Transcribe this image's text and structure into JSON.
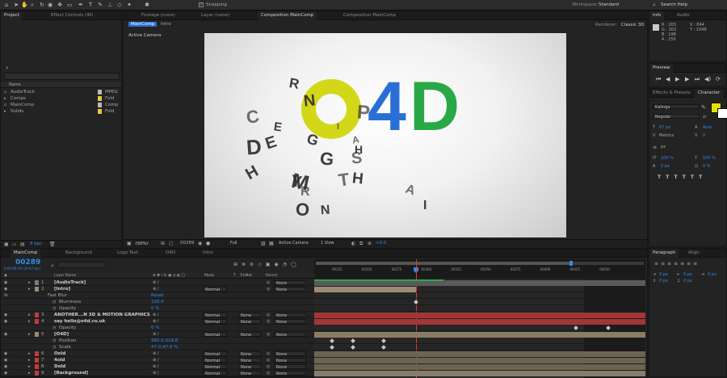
{
  "app": {
    "workspace_label": "Workspace:",
    "workspace_value": "Standard",
    "search_help": "Search Help",
    "snapping": "Snapping"
  },
  "project": {
    "tab": "Project",
    "tab2": "Effect Controls (4D",
    "col_name": "Name",
    "items": [
      {
        "name": "AudioTrack",
        "type": "MPEG",
        "color": "#b8b8b8"
      },
      {
        "name": "Comps",
        "type": "Fold",
        "color": "#e6c83c"
      },
      {
        "name": "MainComp",
        "type": "Comp",
        "color": "#b8b8b8"
      },
      {
        "name": "Solids",
        "type": "Fold",
        "color": "#e6c83c"
      }
    ],
    "bpc": "8 bpc"
  },
  "viewer": {
    "tabs": [
      "Footage (none)",
      "Layer (none)",
      "Composition MainComp",
      "Composition MainComp"
    ],
    "crumbs": [
      "MainComp",
      "Intro"
    ],
    "renderer_label": "Renderer:",
    "renderer_value": "Classic 3D",
    "active_camera": "Active Camera",
    "logo": {
      "o_color": "#d2d817",
      "four_color": "#2a6fd6",
      "d_color": "#2aa847"
    },
    "bottom": {
      "zoom": "(50%)",
      "frame": "00289",
      "resolution": "Full",
      "camera": "Active Camera",
      "views": "1 View",
      "offset": "+0.0"
    },
    "letters": [
      "C",
      "R",
      "N",
      "P",
      "E",
      "G",
      "I",
      "D",
      "E",
      "A",
      "G",
      "H",
      "S",
      "M",
      "O",
      "T",
      "H",
      "N",
      "R",
      "I",
      "H",
      "A",
      "Y"
    ]
  },
  "info": {
    "tab": "Info",
    "tab2": "Audio",
    "r": "R : 203",
    "g": "G : 202",
    "b": "B : 198",
    "a": "A : 255",
    "x": "X : 844",
    "y": "Y : 1048"
  },
  "preview": {
    "tab": "Preview"
  },
  "character": {
    "tab1": "Effects & Presets",
    "tab2": "Character",
    "font": "Kalinga",
    "style": "Regular",
    "size": "67 px",
    "leading": "Auto",
    "tracking": "0",
    "unit": "px",
    "vscale": "100 %",
    "hscale": "100 %",
    "baseline": "0 px",
    "tsume": "0 %",
    "swatch_fill": "#e4e000"
  },
  "paragraph": {
    "tab1": "Paragraph",
    "tab2": "Align",
    "values": [
      "0 px",
      "0 px",
      "0 px",
      "0 px",
      "0 px"
    ]
  },
  "timeline": {
    "tabs": [
      "MainComp",
      "Background",
      "Logo Text",
      "O4D",
      "Intro"
    ],
    "timecode": "00289",
    "timecode_sub": "0:00:09:19 (29.97 fps)",
    "col_layer": "Layer Name",
    "col_mode": "Mode",
    "col_t": "T",
    "col_trkmat": "TrkMat",
    "col_parent": "Parent",
    "ruler": [
      "00225",
      "00250",
      "00275",
      "00300",
      "00325",
      "00350",
      "00375",
      "00400",
      "00425",
      "00450"
    ],
    "rows": [
      {
        "num": "1",
        "name": "[AudioTrack]",
        "color": "#7b7b7b",
        "mode": "",
        "trk": "",
        "parent": "None",
        "kind": "layer"
      },
      {
        "num": "2",
        "name": "[Intro]",
        "color": "#9a8c74",
        "mode": "Normal",
        "trk": "",
        "parent": "None",
        "kind": "layer"
      },
      {
        "num": "",
        "name": "Fast Blur",
        "value": "Reset",
        "kind": "effect"
      },
      {
        "num": "",
        "name": "Blurriness",
        "value": "100.0",
        "kind": "prop"
      },
      {
        "num": "",
        "name": "Opacity",
        "value": "0 %",
        "kind": "prop"
      },
      {
        "num": "3",
        "name": "ANOTHER...N 3D & MOTION GRAPHICS",
        "color": "#c23c3c",
        "mode": "Normal",
        "trk": "None",
        "parent": "None",
        "kind": "layer"
      },
      {
        "num": "4",
        "name": "say hello@o4d.co.uk",
        "color": "#c23c3c",
        "mode": "Normal",
        "trk": "None",
        "parent": "None",
        "kind": "layer"
      },
      {
        "num": "",
        "name": "Opacity",
        "value": "0 %",
        "kind": "prop"
      },
      {
        "num": "5",
        "name": "[O4D]",
        "color": "#9a8c74",
        "mode": "Normal",
        "trk": "None",
        "parent": "None",
        "kind": "layer"
      },
      {
        "num": "",
        "name": "Position",
        "value": "960.0,919.8",
        "kind": "prop"
      },
      {
        "num": "",
        "name": "Scale",
        "value": "47.0,47.0 %",
        "kind": "prop"
      },
      {
        "num": "6",
        "name": "Oold",
        "color": "#c23c3c",
        "mode": "Normal",
        "trk": "None",
        "parent": "None",
        "kind": "layer"
      },
      {
        "num": "7",
        "name": "4old",
        "color": "#c23c3c",
        "mode": "Normal",
        "trk": "None",
        "parent": "None",
        "kind": "layer"
      },
      {
        "num": "8",
        "name": "Dold",
        "color": "#c23c3c",
        "mode": "Normal",
        "trk": "None",
        "parent": "None",
        "kind": "layer"
      },
      {
        "num": "9",
        "name": "[Background]",
        "color": "#c23c3c",
        "mode": "Normal",
        "trk": "None",
        "parent": "None",
        "kind": "layer"
      }
    ]
  }
}
